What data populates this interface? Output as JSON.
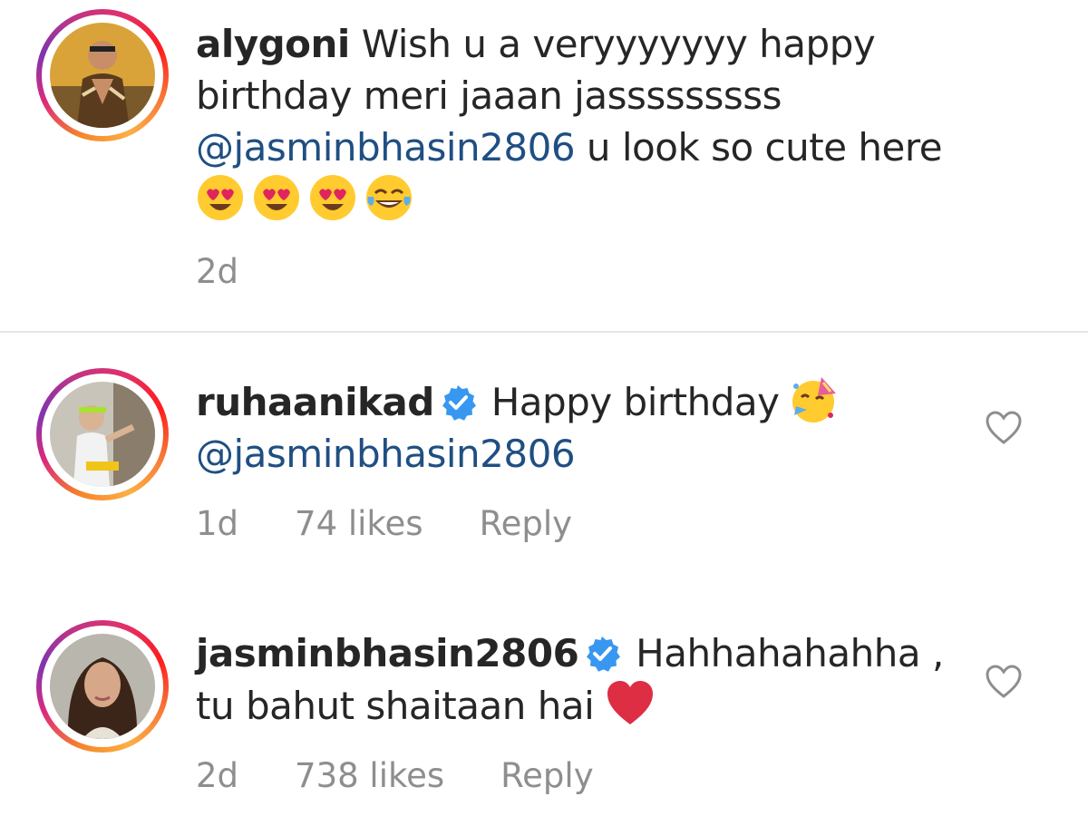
{
  "comments": [
    {
      "username": "alygoni",
      "text_part1": " Wish u a veryyyyyyy happy birthday meri jaaan jasssssssss ",
      "mention": "@jasmin​bhasin2806",
      "text_part2": " u look so cute here",
      "emojis": [
        "heart-eyes-emoji",
        "heart-eyes-emoji",
        "heart-eyes-emoji",
        "tears-of-joy-emoji"
      ],
      "time": "2d"
    },
    {
      "username": "ruhaanikad",
      "verified": true,
      "text_part1": " Happy birthday ",
      "emoji": "partying-face-emoji",
      "mention": "@jasmin​bhasin2806",
      "time": "1d",
      "likes": "74 likes",
      "reply": "Reply"
    },
    {
      "username": "jasminbhasin2806",
      "verified": true,
      "text_part1": " Hahhahahahha , tu bahut shaitaan hai ",
      "emoji": "red-heart-emoji",
      "time": "2d",
      "likes": "738 likes",
      "reply": "Reply"
    }
  ],
  "colors": {
    "mention": "#1f4f82",
    "meta": "#8e8e8e",
    "verified": "#3897f0"
  }
}
